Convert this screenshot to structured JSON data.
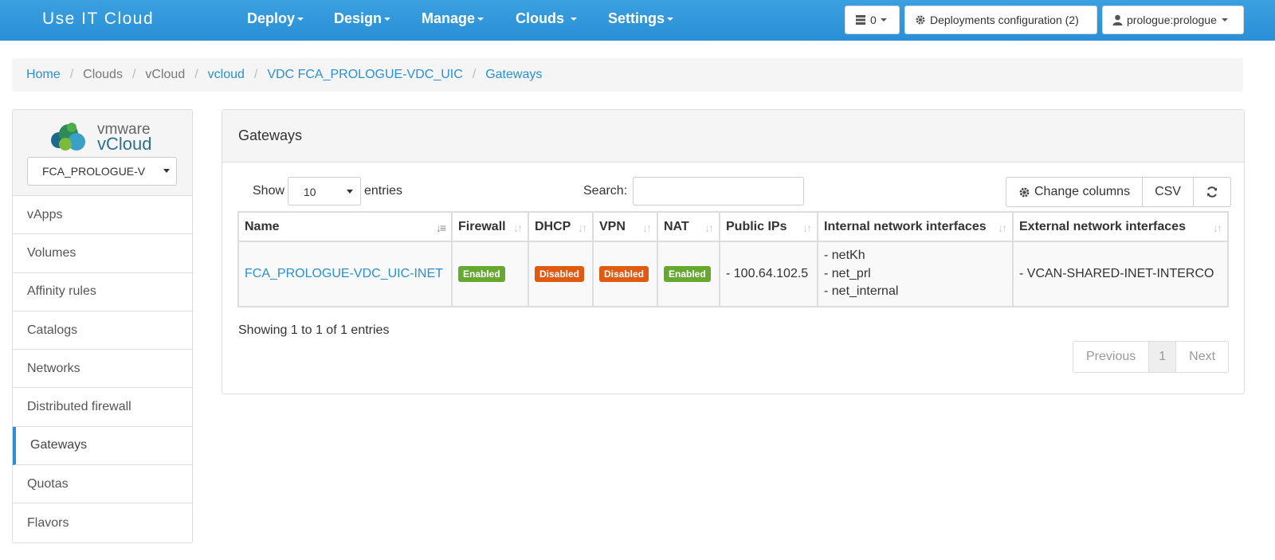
{
  "app": {
    "title": "Use IT Cloud"
  },
  "nav": {
    "items": [
      {
        "label": "Deploy"
      },
      {
        "label": "Design"
      },
      {
        "label": "Manage"
      },
      {
        "label": "Clouds"
      },
      {
        "label": "Settings"
      }
    ],
    "notifications_count": "0",
    "deployments_config": "Deployments configuration (2)",
    "user": "prologue:prologue"
  },
  "breadcrumb": [
    "Home",
    "Clouds",
    "vCloud",
    "vcloud",
    "VDC FCA_PROLOGUE-VDC_UIC",
    "Gateways"
  ],
  "sidebar": {
    "logo_text_top": "vmware",
    "logo_text_bottom": "vCloud",
    "vdc_select": "FCA_PROLOGUE-V",
    "items": [
      {
        "label": "vApps"
      },
      {
        "label": "Volumes"
      },
      {
        "label": "Affinity rules"
      },
      {
        "label": "Catalogs"
      },
      {
        "label": "Networks"
      },
      {
        "label": "Distributed firewall"
      },
      {
        "label": "Gateways"
      },
      {
        "label": "Quotas"
      },
      {
        "label": "Flavors"
      }
    ]
  },
  "panel": {
    "title": "Gateways",
    "show_label": "Show",
    "page_length": "10",
    "entries_label": "entries",
    "search_label": "Search:",
    "search_value": "",
    "change_columns": "Change columns",
    "csv": "CSV",
    "columns": [
      "Name",
      "Firewall",
      "DHCP",
      "VPN",
      "NAT",
      "Public IPs",
      "Internal network interfaces",
      "External network interfaces"
    ],
    "rows": [
      {
        "name": "FCA_PROLOGUE-VDC_UIC-INET",
        "firewall": "Enabled",
        "dhcp": "Disabled",
        "vpn": "Disabled",
        "nat": "Enabled",
        "public_ips": "- 100.64.102.5",
        "internal": [
          "- netKh",
          "- net_prl",
          "- net_internal"
        ],
        "external": "- VCAN-SHARED-INET-INTERCO"
      }
    ],
    "info": "Showing 1 to 1 of 1 entries",
    "pager": {
      "previous": "Previous",
      "current": "1",
      "next": "Next"
    }
  },
  "colors": {
    "navbar": "#2a8fd6",
    "link": "#2a8fd6",
    "enabled_badge": "#67a830",
    "disabled_badge": "#e05a12"
  }
}
